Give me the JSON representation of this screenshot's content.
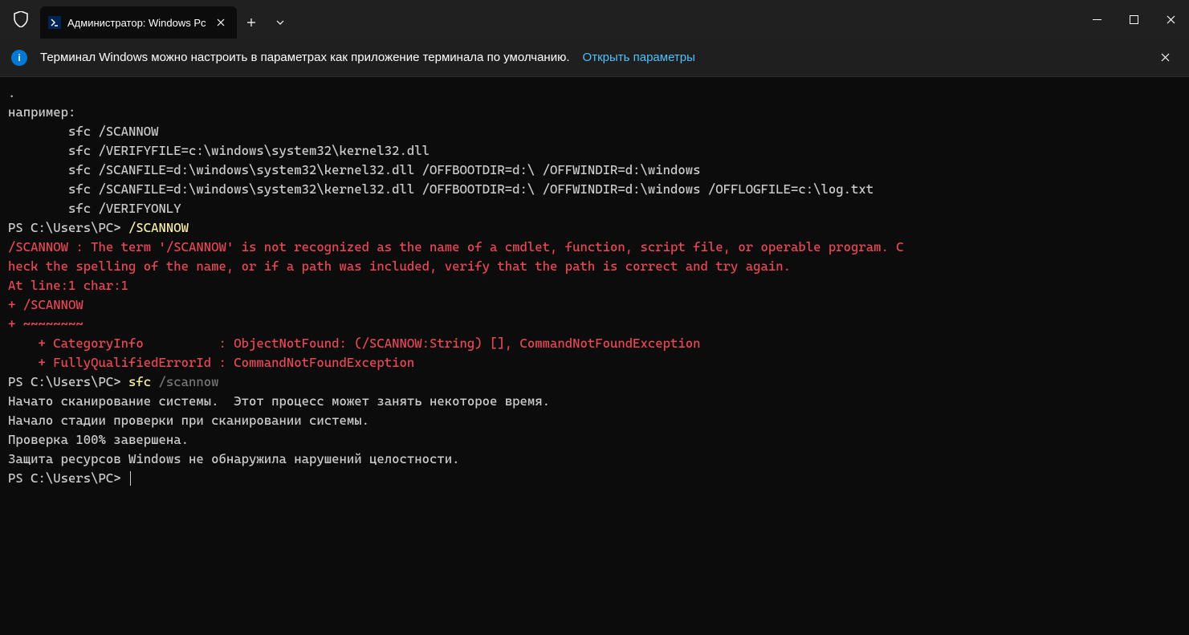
{
  "titlebar": {
    "tab_title": "Администратор: Windows Pc",
    "shield_color": "#ffffff"
  },
  "infobar": {
    "message": "Терминал Windows можно настроить в параметрах как приложение терминала по умолчанию.",
    "link": "Открыть параметры"
  },
  "terminal": {
    "lines": [
      {
        "segments": [
          {
            "cls": "fg-default",
            "text": "."
          }
        ]
      },
      {
        "segments": [
          {
            "cls": "fg-default",
            "text": ""
          }
        ]
      },
      {
        "segments": [
          {
            "cls": "fg-default",
            "text": "например:"
          }
        ]
      },
      {
        "segments": [
          {
            "cls": "fg-default",
            "text": ""
          }
        ]
      },
      {
        "segments": [
          {
            "cls": "fg-default",
            "text": "        sfc /SCANNOW"
          }
        ]
      },
      {
        "segments": [
          {
            "cls": "fg-default",
            "text": "        sfc /VERIFYFILE=c:\\windows\\system32\\kernel32.dll"
          }
        ]
      },
      {
        "segments": [
          {
            "cls": "fg-default",
            "text": "        sfc /SCANFILE=d:\\windows\\system32\\kernel32.dll /OFFBOOTDIR=d:\\ /OFFWINDIR=d:\\windows"
          }
        ]
      },
      {
        "segments": [
          {
            "cls": "fg-default",
            "text": "        sfc /SCANFILE=d:\\windows\\system32\\kernel32.dll /OFFBOOTDIR=d:\\ /OFFWINDIR=d:\\windows /OFFLOGFILE=c:\\log.txt"
          }
        ]
      },
      {
        "segments": [
          {
            "cls": "fg-default",
            "text": "        sfc /VERIFYONLY"
          }
        ]
      },
      {
        "segments": [
          {
            "cls": "fg-default",
            "text": "PS C:\\Users\\PC> "
          },
          {
            "cls": "fg-yellow",
            "text": "/SCANNOW"
          }
        ]
      },
      {
        "segments": [
          {
            "cls": "fg-red",
            "text": "/SCANNOW : The term '/SCANNOW' is not recognized as the name of a cmdlet, function, script file, or operable program. C"
          }
        ]
      },
      {
        "segments": [
          {
            "cls": "fg-red",
            "text": "heck the spelling of the name, or if a path was included, verify that the path is correct and try again."
          }
        ]
      },
      {
        "segments": [
          {
            "cls": "fg-red",
            "text": "At line:1 char:1"
          }
        ]
      },
      {
        "segments": [
          {
            "cls": "fg-red",
            "text": "+ /SCANNOW"
          }
        ]
      },
      {
        "segments": [
          {
            "cls": "fg-red",
            "text": "+ ~~~~~~~~"
          }
        ]
      },
      {
        "segments": [
          {
            "cls": "fg-red",
            "text": "    + CategoryInfo          : ObjectNotFound: (/SCANNOW:String) [], CommandNotFoundException"
          }
        ]
      },
      {
        "segments": [
          {
            "cls": "fg-red",
            "text": "    + FullyQualifiedErrorId : CommandNotFoundException"
          }
        ]
      },
      {
        "segments": [
          {
            "cls": "fg-default",
            "text": ""
          }
        ]
      },
      {
        "segments": [
          {
            "cls": "fg-default",
            "text": "PS C:\\Users\\PC> "
          },
          {
            "cls": "fg-yellow",
            "text": "sfc "
          },
          {
            "cls": "fg-gray",
            "text": "/scannow"
          }
        ]
      },
      {
        "segments": [
          {
            "cls": "fg-default",
            "text": ""
          }
        ]
      },
      {
        "segments": [
          {
            "cls": "fg-default",
            "text": "Начато сканирование системы.  Этот процесс может занять некоторое время."
          }
        ]
      },
      {
        "segments": [
          {
            "cls": "fg-default",
            "text": ""
          }
        ]
      },
      {
        "segments": [
          {
            "cls": "fg-default",
            "text": "Начало стадии проверки при сканировании системы."
          }
        ]
      },
      {
        "segments": [
          {
            "cls": "fg-default",
            "text": "Проверка 100% завершена."
          }
        ]
      },
      {
        "segments": [
          {
            "cls": "fg-default",
            "text": ""
          }
        ]
      },
      {
        "segments": [
          {
            "cls": "fg-default",
            "text": "Защита ресурсов Windows не обнаружила нарушений целостности."
          }
        ]
      },
      {
        "segments": [
          {
            "cls": "fg-default",
            "text": "PS C:\\Users\\PC> "
          }
        ],
        "cursor": true
      }
    ]
  }
}
